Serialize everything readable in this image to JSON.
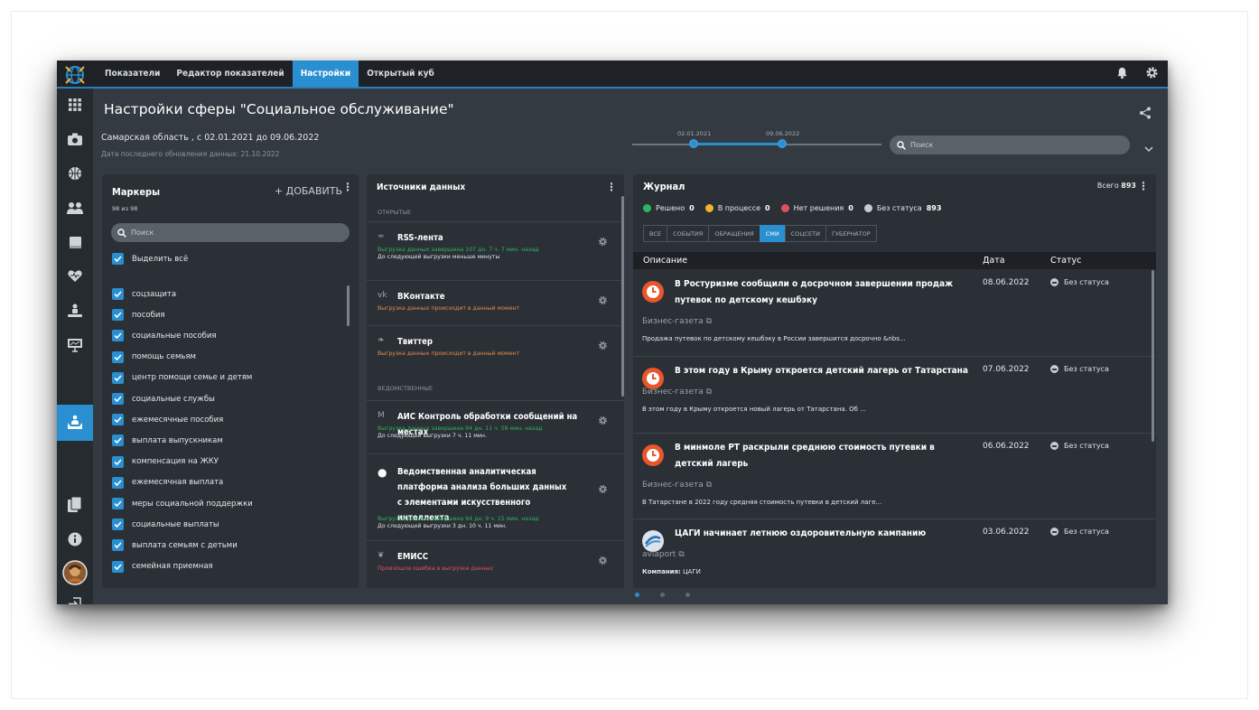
{
  "topbar": {
    "tabs": [
      {
        "label": "Показатели"
      },
      {
        "label": "Редактор показателей"
      },
      {
        "label": "Настройки",
        "active": true
      },
      {
        "label": "Открытый куб"
      }
    ],
    "icons": [
      "notifications-icon",
      "gear-icon"
    ]
  },
  "sidebar": {
    "icons": [
      "apps-grid-icon",
      "camera-icon",
      "basketball-icon",
      "people-icon",
      "book-icon",
      "heart-icon",
      "charity-icon",
      "presentation-icon",
      "social-care-icon",
      "documents-icon",
      "info-icon",
      "avatar",
      "logout-icon"
    ],
    "active": "social-care-icon"
  },
  "header": {
    "title": "Настройки сферы \"Социальное обслуживание\"",
    "subtitle": "Самарская область , с 02.01.2021 до 09.06.2022",
    "last_update": "Дата последнего обновления данных: 21.10.2022"
  },
  "timeline": {
    "start_label": "02.01.2021",
    "end_label": "09.06.2022",
    "range_start": 0.25,
    "range_end": 0.6
  },
  "search": {
    "placeholder": "Поиск"
  },
  "markers": {
    "title": "Маркеры",
    "add_label": "+ ДОБАВИТЬ",
    "count": "98 из 98",
    "search_placeholder": "Поиск",
    "select_all": "Выделить всё",
    "items": [
      "соцзащита",
      "пособия",
      "социальные пособия",
      "помощь семьям",
      "центр помощи семье и детям",
      "социальные службы",
      "ежемесячные пособия",
      "выплата выпускникам",
      "компенсация на ЖКУ",
      "ежемесячная выплата",
      "меры социальной поддержки",
      "социальные выплаты",
      "выплата семьям с детьми",
      "семейная приемная"
    ]
  },
  "sources": {
    "title": "Источники данных",
    "open_section": "ОТКРЫТЫЕ",
    "dept_section": "ВЕДОМСТВЕННЫЕ",
    "items": [
      {
        "icon": "rss-icon",
        "glyph": "≈",
        "name": "RSS-лента",
        "status": "Выгрузка данных завершена 107 дн. 7 ч. 7 мин. назад",
        "status_color": "green",
        "next": "До следующей выгрузки меньше минуты"
      },
      {
        "icon": "vk-icon",
        "glyph": "vk",
        "name": "ВКонтакте",
        "status": "Выгрузка данных происходит в данный момент",
        "status_color": "orange",
        "next": ""
      },
      {
        "icon": "twitter-icon",
        "glyph": "❧",
        "name": "Твиттер",
        "status": "Выгрузка данных происходит в данный момент",
        "status_color": "orange",
        "next": ""
      },
      {
        "icon": "ais-icon",
        "glyph": "M",
        "name": "АИС Контроль обработки сообщений на местах",
        "status": "Выгрузка данных завершена 94 дн. 11 ч. 58 мин. назад",
        "status_color": "green",
        "next": "До следующей выгрузки 7 ч. 11 мин."
      },
      {
        "icon": "platform-icon",
        "glyph": "●",
        "name": "Ведомственная аналитическая платформа анализа больших данных с элементами искусственного интеллекта",
        "status": "Выгрузка данных завершена 94 дн. 9 ч. 15 мин. назад",
        "status_color": "green",
        "next": "До следующей выгрузки 3 дн. 10 ч. 11 мин."
      },
      {
        "icon": "emiss-icon",
        "glyph": "❦",
        "name": "ЕМИСС",
        "status": "Произошла ошибка в выгрузке данных",
        "status_color": "red",
        "next": ""
      }
    ]
  },
  "journal": {
    "title": "Журнал",
    "total_label": "Всего",
    "total": "893",
    "legend": [
      {
        "label": "Решено",
        "count": "0",
        "color": "#2bb75c"
      },
      {
        "label": "В процессе",
        "count": "0",
        "color": "#f2b32a"
      },
      {
        "label": "Нет решения",
        "count": "0",
        "color": "#e0505f"
      },
      {
        "label": "Без статуса",
        "count": "893",
        "color": "#c7ccd2"
      }
    ],
    "filter_tabs": [
      "ВСЕ",
      "СОБЫТИЯ",
      "ОБРАЩЕНИЯ",
      "СМИ",
      "СОЦСЕТИ",
      "ГУБЕРНАТОР"
    ],
    "active_filter": "СМИ",
    "columns": {
      "description": "Описание",
      "date": "Дата",
      "status": "Статус"
    },
    "rows": [
      {
        "title": "В Ростуризме сообщили о досрочном завершении продаж путевок по детскому кешбэку",
        "date": "08.06.2022",
        "status": "Без статуса",
        "source": "Бизнес-газета",
        "snippet": "Продажа путевок по детскому кешбэку в России завершится досрочно &nbs..."
      },
      {
        "title": "В этом году в Крыму откроется детский лагерь от Татарстана",
        "date": "07.06.2022",
        "status": "Без статуса",
        "source": "Бизнес-газета",
        "snippet": "В этом году в Крыму откроется новый лагерь от Татарстана. Об ..."
      },
      {
        "title": "В минмоле РТ раскрыли среднюю стоимость путевки в детский лагерь",
        "date": "06.06.2022",
        "status": "Без статуса",
        "source": "Бизнес-газета",
        "snippet": "В Татарстане в 2022 году средняя стоимость путевки в детский лаге..."
      },
      {
        "title": "ЦАГИ начинает летнюю оздоровительную кампанию",
        "date": "03.06.2022",
        "status": "Без статуса",
        "source": "aviaport",
        "snippet_label": "Компания:",
        "snippet": "ЦАГИ"
      }
    ]
  },
  "pager": {
    "pages": 3,
    "active": 0
  },
  "colors": {
    "accent": "#2a8fd0",
    "panel": "#2b3036",
    "background": "#343a41",
    "topbar": "#1e2226"
  }
}
